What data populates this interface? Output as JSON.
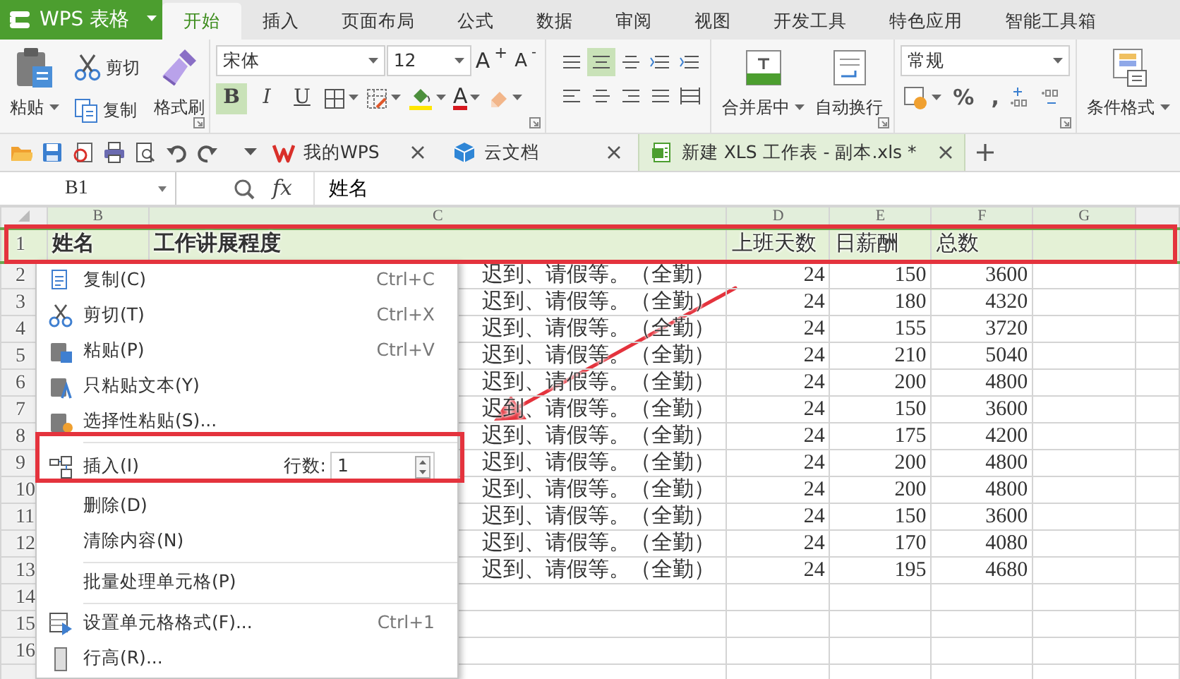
{
  "app_button": {
    "label": "WPS 表格"
  },
  "ribbon_tabs": [
    {
      "label": "开始",
      "selected": true
    },
    {
      "label": "插入",
      "selected": false
    },
    {
      "label": "页面布局",
      "selected": false
    },
    {
      "label": "公式",
      "selected": false
    },
    {
      "label": "数据",
      "selected": false
    },
    {
      "label": "审阅",
      "selected": false
    },
    {
      "label": "视图",
      "selected": false
    },
    {
      "label": "开发工具",
      "selected": false
    },
    {
      "label": "特色应用",
      "selected": false
    },
    {
      "label": "智能工具箱",
      "selected": false
    }
  ],
  "clipboard": {
    "paste": "粘贴",
    "cut": "剪切",
    "copy": "复制",
    "format_painter": "格式刷"
  },
  "font": {
    "name": "宋体",
    "size": "12",
    "grow": "A$^{+}$",
    "shrink": "A$^{-}$",
    "font_color": "A",
    "styles": [
      {
        "label": "B",
        "selected": true
      },
      {
        "label": "I",
        "selected": false
      },
      {
        "label": "U",
        "selected": false
      }
    ]
  },
  "alignment": [
    {
      "selected": false
    },
    {
      "selected": true
    },
    {
      "selected": false
    },
    {
      "selected": false
    },
    {
      "selected": false
    },
    {
      "selected": false
    },
    {
      "selected": false
    },
    {
      "selected": false
    },
    {
      "selected": false
    },
    {
      "selected": false
    }
  ],
  "cells_group": {
    "merge": "合并居中",
    "wrap": "自动换行"
  },
  "number": {
    "format": "常规",
    "buttons": [
      "%",
      ","
    ]
  },
  "styles_group": {
    "conditional_format": "条件格式"
  },
  "doc_tabs": [
    {
      "label": "我的WPS",
      "kind": "wps",
      "selected": false
    },
    {
      "label": "云文档",
      "kind": "cloud",
      "selected": false
    },
    {
      "label": "新建 XLS 工作表 - 副本.xls *",
      "kind": "sheet",
      "selected": true
    }
  ],
  "formula_bar": {
    "cell_ref": "B1",
    "fx": "fx",
    "formula": "姓名"
  },
  "columns": [
    "B",
    "C",
    "D",
    "E",
    "F",
    "G"
  ],
  "row_numbers": [
    "1",
    "2",
    "3",
    "4",
    "5",
    "6",
    "7",
    "8",
    "9",
    "10",
    "11",
    "12",
    "13",
    "14",
    "15",
    "16"
  ],
  "rows": [
    {
      "kind": "header",
      "selected": true,
      "name": "姓名",
      "progress": "工作讲展程度",
      "days": "上班天数",
      "daily_pay": "日薪酬",
      "total": "总数"
    },
    {
      "kind": "data",
      "selected": false,
      "progress": "迟到、请假等。（全勤）",
      "days": "24",
      "daily_pay": "150",
      "total": "3600"
    },
    {
      "kind": "data",
      "selected": false,
      "progress": "迟到、请假等。（全勤）",
      "days": "24",
      "daily_pay": "180",
      "total": "4320"
    },
    {
      "kind": "data",
      "selected": false,
      "progress": "迟到、请假等。（全勤）",
      "days": "24",
      "daily_pay": "155",
      "total": "3720"
    },
    {
      "kind": "data",
      "selected": false,
      "progress": "迟到、请假等。（全勤）",
      "days": "24",
      "daily_pay": "210",
      "total": "5040"
    },
    {
      "kind": "data",
      "selected": false,
      "progress": "迟到、请假等。（全勤）",
      "days": "24",
      "daily_pay": "200",
      "total": "4800"
    },
    {
      "kind": "data",
      "selected": false,
      "progress": "迟到、请假等。（全勤）",
      "days": "24",
      "daily_pay": "150",
      "total": "3600"
    },
    {
      "kind": "data",
      "selected": false,
      "progress": "迟到、请假等。（全勤）",
      "days": "24",
      "daily_pay": "175",
      "total": "4200"
    },
    {
      "kind": "data",
      "selected": false,
      "progress": "迟到、请假等。（全勤）",
      "days": "24",
      "daily_pay": "200",
      "total": "4800"
    },
    {
      "kind": "data",
      "selected": false,
      "progress": "迟到、请假等。（全勤）",
      "days": "24",
      "daily_pay": "200",
      "total": "4800"
    },
    {
      "kind": "data",
      "selected": false,
      "progress": "迟到、请假等。（全勤）",
      "days": "24",
      "daily_pay": "150",
      "total": "3600"
    },
    {
      "kind": "data",
      "selected": false,
      "progress": "迟到、请假等。（全勤）",
      "days": "24",
      "daily_pay": "170",
      "total": "4080"
    },
    {
      "kind": "data",
      "selected": false,
      "progress": "迟到、请假等。（全勤）",
      "days": "24",
      "daily_pay": "195",
      "total": "4680"
    }
  ],
  "context_menu": [
    {
      "kind": "item",
      "label": "复制(C)",
      "shortcut": "Ctrl+C"
    },
    {
      "kind": "item",
      "label": "剪切(T)",
      "shortcut": "Ctrl+X"
    },
    {
      "kind": "item",
      "label": "粘贴(P)",
      "shortcut": "Ctrl+V"
    },
    {
      "kind": "item",
      "label": "只粘贴文本(Y)"
    },
    {
      "kind": "item",
      "label": "选择性粘贴(S)..."
    },
    {
      "kind": "separator"
    },
    {
      "kind": "insert",
      "label": "插入(I)",
      "count_label": "行数:",
      "count": "1"
    },
    {
      "kind": "item",
      "label": "删除(D)"
    },
    {
      "kind": "item",
      "label": "清除内容(N)"
    },
    {
      "kind": "separator"
    },
    {
      "kind": "item",
      "label": "批量处理单元格(P)"
    },
    {
      "kind": "separator"
    },
    {
      "kind": "item",
      "label": "设置单元格格式(F)...",
      "shortcut": "Ctrl+1"
    },
    {
      "kind": "item",
      "label": "行高(R)..."
    }
  ]
}
